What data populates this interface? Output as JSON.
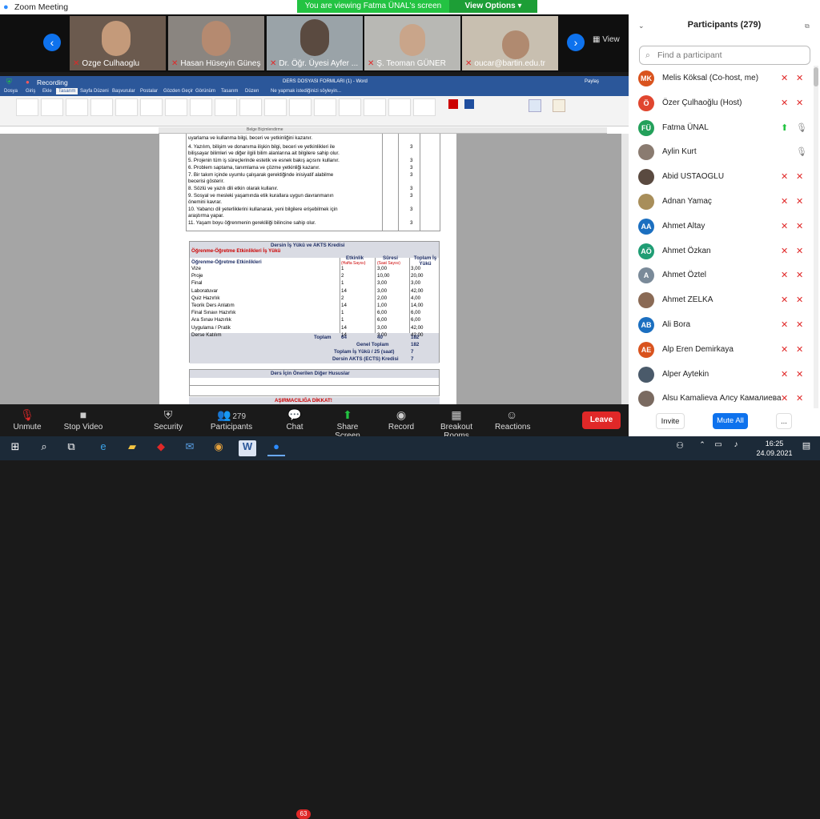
{
  "app": {
    "title": "Zoom Meeting"
  },
  "share_banner": {
    "message": "You are viewing Fatma ÜNAL's screen",
    "view_options": "View Options"
  },
  "gallery": {
    "view_label": "View",
    "tiles": [
      {
        "name": "Ozge Culhaoglu"
      },
      {
        "name": "Hasan Hüseyin Güneş"
      },
      {
        "name": "Dr. Öğr. Üyesi Ayfer ..."
      },
      {
        "name": "Ş. Teoman GÜNER"
      },
      {
        "name": "oucar@bartin.edu.tr"
      }
    ]
  },
  "word": {
    "recording": "Recording",
    "doc_title": "DERS DOSYASI FORMLARI (1) - Word",
    "search_hint": "Ne yapmak istediğinizi söyleyin...",
    "share": "Paylaş",
    "tabs": [
      "Dosya",
      "Giriş",
      "Ekle",
      "Tasarım",
      "Sayfa Düzeni",
      "Başvurular",
      "Postalar",
      "Gözden Geçir",
      "Görünüm",
      "Tasarım",
      "Düzen"
    ],
    "ruler_label": "Belge Biçimlendirme"
  },
  "document": {
    "outcomes": [
      {
        "text": "uyarlama ve kullanma bilgi, beceri ve yetkinliğini kazanır.",
        "score": ""
      },
      {
        "text": "4. Yazılım, bilişim ve donanıma ilişkin bilgi, beceri ve yetkinlikleri ile",
        "score": "3"
      },
      {
        "text": "bilişsayar bilimleri ve diğer ilgili bilim alanlarına ait bilgilere sahip olur.",
        "score": ""
      },
      {
        "text": "5. Projenin tüm iş süreçlerinde estetik ve esnek bakış açısını kullanır.",
        "score": "3"
      },
      {
        "text": "6. Problem saptama, tanımlama ve çözme yetkinliği kazanır.",
        "score": "3"
      },
      {
        "text": "7. Bir takım içinde uyumlu çalışarak gerektiğinde inisiyatif alabilme",
        "score": "3"
      },
      {
        "text": "becerisi gösterir.",
        "score": ""
      },
      {
        "text": "8. Sözlü ve yazılı dili etkin olarak kullanır.",
        "score": "3"
      },
      {
        "text": "9. Sosyal ve mesleki yaşamında etik kurallara uygun davranmanın",
        "score": "3"
      },
      {
        "text": "önemini kavrar.",
        "score": ""
      },
      {
        "text": "10. Yabancı dil yeterliklerini kullanarak, yeni bilgilere erişebilmek için",
        "score": "3"
      },
      {
        "text": "araştırma yapar.",
        "score": ""
      },
      {
        "text": "11. Yaşam boyu öğrenmenin gerekliliği bilincine sahip olur.",
        "score": "3"
      }
    ],
    "workload": {
      "title": "Dersin İş Yükü ve AKTS Kredisi",
      "subtitle": "Öğrenme-Öğretme Etkinlikleri İş Yükü",
      "col_activity": "Öğrenme-Öğretme Etkinlikleri",
      "col_count": "Etkinlik",
      "col_count_sub": "(Hafta Sayısı)",
      "col_duration": "Süresi",
      "col_duration_sub": "(Saat Sayısı)",
      "col_total": "Toplam İş Yükü",
      "rows": [
        {
          "name": "Vize",
          "count": "1",
          "dur": "3,00",
          "total": "3,00"
        },
        {
          "name": "Proje",
          "count": "2",
          "dur": "10,00",
          "total": "20,00"
        },
        {
          "name": "Final",
          "count": "1",
          "dur": "3,00",
          "total": "3,00"
        },
        {
          "name": "Laboratuvar",
          "count": "14",
          "dur": "3,00",
          "total": "42,00"
        },
        {
          "name": "Quiz Hazırlık",
          "count": "2",
          "dur": "2,00",
          "total": "4,00"
        },
        {
          "name": "Teorik Ders Anlatım",
          "count": "14",
          "dur": "1,00",
          "total": "14,00"
        },
        {
          "name": "Final Sınavı Hazırlık",
          "count": "1",
          "dur": "6,00",
          "total": "6,00"
        },
        {
          "name": "Ara Sınav Hazırlık",
          "count": "1",
          "dur": "6,00",
          "total": "6,00"
        },
        {
          "name": "Uygulama / Pratik",
          "count": "14",
          "dur": "3,00",
          "total": "42,00"
        },
        {
          "name": "Derse Katılım",
          "count": "14",
          "dur": "3,00",
          "total": "42,00"
        }
      ],
      "toplam_label": "Toplam",
      "toplam_count": "64",
      "toplam_dur": "40",
      "toplam_total": "182",
      "genel_label": "Genel Toplam",
      "genel_value": "182",
      "is_yuku_label": "Toplam İş Yükü / 25 (saat)",
      "is_yuku_value": "7",
      "akts_label": "Dersin AKTS (ECTS) Kredisi",
      "akts_value": "7"
    },
    "other_title": "Ders İçin Önerilen Diğer Hususlar",
    "warning": "AŞIRMACILIĞA DİKKAT!"
  },
  "toolbar": {
    "unmute": "Unmute",
    "stop_video": "Stop Video",
    "security": "Security",
    "participants": "Participants",
    "participants_count": "279",
    "chat": "Chat",
    "chat_badge": "63",
    "share_screen": "Share Screen",
    "record": "Record",
    "breakout": "Breakout Rooms",
    "reactions": "Reactions",
    "leave": "Leave"
  },
  "panel": {
    "title": "Participants (279)",
    "search_placeholder": "Find a participant",
    "participants": [
      {
        "initials": "MK",
        "name": "Melis Köksal (Co-host, me)",
        "color": "#d9531e"
      },
      {
        "initials": "Ö",
        "name": "Özer Çulhaoğlu (Host)",
        "color": "#e0462f"
      },
      {
        "initials": "FÜ",
        "name": "Fatma ÜNAL",
        "color": "#23a05a"
      },
      {
        "initials": "",
        "name": "Aylin Kurt",
        "color": "#8a7b70"
      },
      {
        "initials": "",
        "name": "Abid USTAOGLU",
        "color": "#5a4a40"
      },
      {
        "initials": "",
        "name": "Adnan Yamaç",
        "color": "#a88e5a"
      },
      {
        "initials": "AA",
        "name": "Ahmet Altay",
        "color": "#1b6fc0"
      },
      {
        "initials": "AÖ",
        "name": "Ahmet Özkan",
        "color": "#1f9d74"
      },
      {
        "initials": "A",
        "name": "Ahmet Öztel",
        "color": "#7a8a99"
      },
      {
        "initials": "",
        "name": "Ahmet ZELKA",
        "color": "#8a6a55"
      },
      {
        "initials": "AB",
        "name": "Ali Bora",
        "color": "#1b6fc0"
      },
      {
        "initials": "AE",
        "name": "Alp Eren Demirkaya",
        "color": "#d9531e"
      },
      {
        "initials": "",
        "name": "Alper Aytekin",
        "color": "#4a5a6a"
      },
      {
        "initials": "",
        "name": "Alsu Kamalieva Алсу Камалиева",
        "color": "#7a6a60"
      }
    ],
    "invite": "Invite",
    "mute_all": "Mute All",
    "more": "..."
  },
  "taskbar": {
    "time": "16:25",
    "date": "24.09.2021"
  }
}
